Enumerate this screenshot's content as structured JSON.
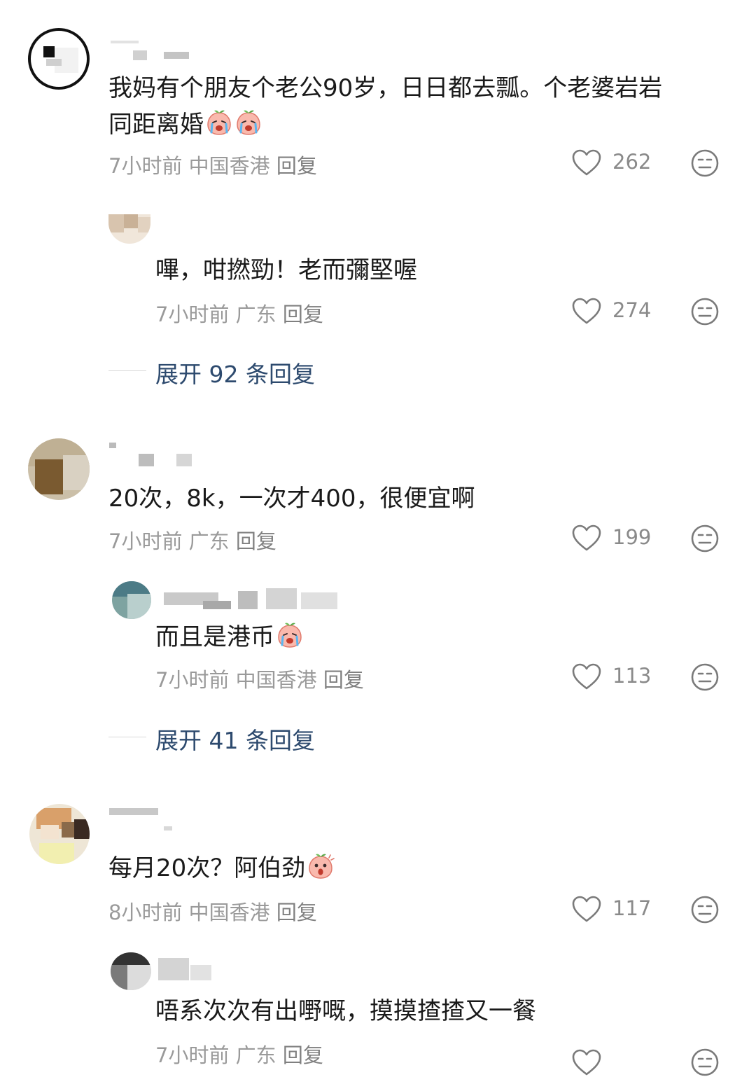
{
  "comments": [
    {
      "text_line1": "我妈有个朋友个老公90岁，日日都去瓢。个老婆岩岩",
      "text_line2": "同距离婚",
      "time": "7小时前",
      "location": "中国香港",
      "reply_label": "回复",
      "likes": "262",
      "emoji": "crying-peach-emoji",
      "reply": {
        "text": "嗶，咁撚勁！老而彌堅喔",
        "time": "7小时前",
        "location": "广东",
        "reply_label": "回复",
        "likes": "274"
      },
      "expand_label": "展开 92 条回复"
    },
    {
      "text": "20次，8k，一次才400，很便宜啊",
      "time": "7小时前",
      "location": "广东",
      "reply_label": "回复",
      "likes": "199",
      "reply": {
        "text": "而且是港币",
        "time": "7小时前",
        "location": "中国香港",
        "reply_label": "回复",
        "likes": "113",
        "emoji": "crying-peach-emoji"
      },
      "expand_label": "展开 41 条回复"
    },
    {
      "text": "每月20次？阿伯劲",
      "time": "8小时前",
      "location": "中国香港",
      "reply_label": "回复",
      "likes": "117",
      "emoji": "shocked-peach-emoji",
      "reply": {
        "text": "唔系次次有出嘢嘅，摸摸揸揸又一餐",
        "time": "7小时前",
        "location": "广东",
        "reply_label": "回复"
      }
    }
  ],
  "colors": {
    "text": "#1a1a1a",
    "meta": "#9a9a9a",
    "expand": "#2d4a6e",
    "icon": "#7a7a7a"
  }
}
